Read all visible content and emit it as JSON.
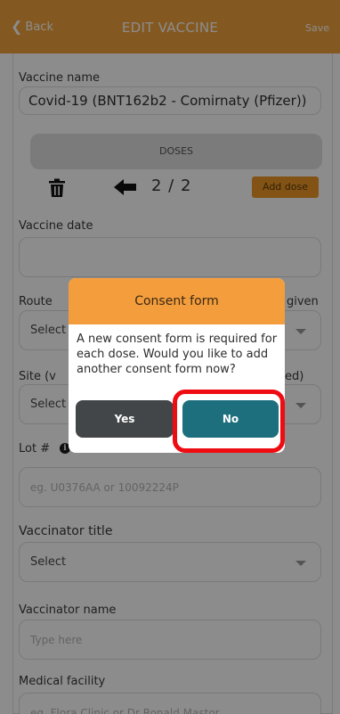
{
  "header": {
    "back_label": "Back",
    "title": "EDIT VACCINE",
    "save_label": "Save"
  },
  "form": {
    "vaccine_name_label": "Vaccine name",
    "vaccine_name_value": "Covid-19 (BNT162b2 - Comirnaty (Pfizer))",
    "doses_label": "DOSES",
    "dose_counter": "2 / 2",
    "add_dose_label": "Add dose",
    "vaccine_date_label": "Vaccine date",
    "vaccine_date_value": "",
    "route_label_start": "Route",
    "route_label_end": "given",
    "route_value": "Select",
    "site_label_start": "Site (v",
    "site_label_end": "ed)",
    "site_value": "Select",
    "lot_label": "Lot #",
    "lot_placeholder": "eg. U0376AA or 10092224P",
    "vaccinator_title_label": "Vaccinator title",
    "vaccinator_title_value": "Select",
    "vaccinator_name_label": "Vaccinator name",
    "vaccinator_name_placeholder": "Type here",
    "medical_facility_label": "Medical facility",
    "medical_facility_placeholder": "eg. Flora Clinic or Dr Ronald Mastor"
  },
  "icons": {
    "trash": "trash-icon",
    "prev": "arrow-left-icon",
    "info": "info-icon",
    "back": "chevron-left-icon"
  },
  "modal": {
    "title": "Consent form",
    "message": "A new consent form is required for each dose. Would you like to add another consent form now?",
    "yes_label": "Yes",
    "no_label": "No"
  },
  "colors": {
    "brand_orange": "#f0a33c",
    "no_button": "#1e6f7d",
    "yes_button": "#434648",
    "highlight": "#ee0c12"
  }
}
